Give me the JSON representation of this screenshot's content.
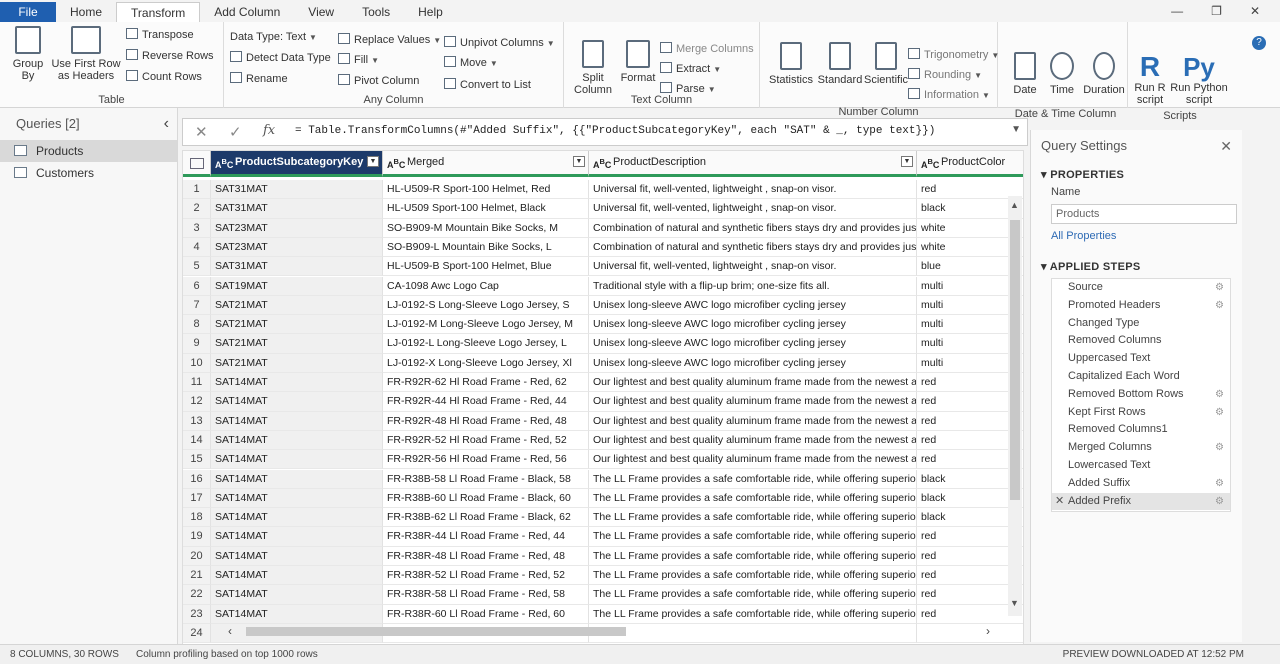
{
  "menu": {
    "tabs": [
      "File",
      "Home",
      "Transform",
      "Add Column",
      "View",
      "Tools",
      "Help"
    ],
    "active": "Transform"
  },
  "ribbon": {
    "table": {
      "label": "Table",
      "group_by": "Group\nBy",
      "use_first_row": "Use First Row\nas Headers",
      "transpose": "Transpose",
      "reverse_rows": "Reverse Rows",
      "count_rows": "Count Rows"
    },
    "any_column": {
      "label": "Any Column",
      "data_type": "Data Type: Text",
      "detect_data_type": "Detect Data Type",
      "rename": "Rename",
      "replace_values": "Replace Values",
      "fill": "Fill",
      "pivot_column": "Pivot Column",
      "unpivot_columns": "Unpivot Columns",
      "move": "Move",
      "convert_to_list": "Convert to List"
    },
    "text_column": {
      "label": "Text Column",
      "split_column": "Split\nColumn",
      "format": "Format",
      "merge_columns": "Merge Columns",
      "extract": "Extract",
      "parse": "Parse"
    },
    "number_column": {
      "label": "Number Column",
      "statistics": "Statistics",
      "standard": "Standard",
      "scientific": "Scientific",
      "trigonometry": "Trigonometry",
      "rounding": "Rounding",
      "information": "Information"
    },
    "datetime_column": {
      "label": "Date & Time Column",
      "date": "Date",
      "time": "Time",
      "duration": "Duration"
    },
    "scripts": {
      "label": "Scripts",
      "run_r": "Run R\nscript",
      "run_python": "Run Python\nscript"
    }
  },
  "queries": {
    "title": "Queries [2]",
    "items": [
      "Products",
      "Customers"
    ]
  },
  "formula": {
    "text": "= Table.TransformColumns(#\"Added Suffix\", {{\"ProductSubcategoryKey\", each \"SAT\" & _, type text}})"
  },
  "grid": {
    "columns": [
      "ProductSubcategoryKey",
      "Merged",
      "ProductDescription",
      "ProductColor"
    ],
    "rows": [
      [
        "1",
        "SAT31MAT",
        "HL-U509-R Sport-100 Helmet, Red",
        "Universal fit, well-vented, lightweight , snap-on visor.",
        "red"
      ],
      [
        "2",
        "SAT31MAT",
        "HL-U509 Sport-100 Helmet, Black",
        "Universal fit, well-vented, lightweight , snap-on visor.",
        "black"
      ],
      [
        "3",
        "SAT23MAT",
        "SO-B909-M Mountain Bike Socks, M",
        "Combination of natural and synthetic fibers stays dry and provides just...",
        "white"
      ],
      [
        "4",
        "SAT23MAT",
        "SO-B909-L Mountain Bike Socks, L",
        "Combination of natural and synthetic fibers stays dry and provides just...",
        "white"
      ],
      [
        "5",
        "SAT31MAT",
        "HL-U509-B Sport-100 Helmet, Blue",
        "Universal fit, well-vented, lightweight , snap-on visor.",
        "blue"
      ],
      [
        "6",
        "SAT19MAT",
        "CA-1098 Awc Logo Cap",
        "Traditional style with a flip-up brim; one-size fits all.",
        "multi"
      ],
      [
        "7",
        "SAT21MAT",
        "LJ-0192-S Long-Sleeve Logo Jersey, S",
        "Unisex long-sleeve AWC logo microfiber cycling jersey",
        "multi"
      ],
      [
        "8",
        "SAT21MAT",
        "LJ-0192-M Long-Sleeve Logo Jersey, M",
        "Unisex long-sleeve AWC logo microfiber cycling jersey",
        "multi"
      ],
      [
        "9",
        "SAT21MAT",
        "LJ-0192-L Long-Sleeve Logo Jersey, L",
        "Unisex long-sleeve AWC logo microfiber cycling jersey",
        "multi"
      ],
      [
        "10",
        "SAT21MAT",
        "LJ-0192-X Long-Sleeve Logo Jersey, Xl",
        "Unisex long-sleeve AWC logo microfiber cycling jersey",
        "multi"
      ],
      [
        "11",
        "SAT14MAT",
        "FR-R92R-62 Hl Road Frame - Red, 62",
        "Our lightest and best quality aluminum frame made from the newest a...",
        "red"
      ],
      [
        "12",
        "SAT14MAT",
        "FR-R92R-44 Hl Road Frame - Red, 44",
        "Our lightest and best quality aluminum frame made from the newest a...",
        "red"
      ],
      [
        "13",
        "SAT14MAT",
        "FR-R92R-48 Hl Road Frame - Red, 48",
        "Our lightest and best quality aluminum frame made from the newest a...",
        "red"
      ],
      [
        "14",
        "SAT14MAT",
        "FR-R92R-52 Hl Road Frame - Red, 52",
        "Our lightest and best quality aluminum frame made from the newest a...",
        "red"
      ],
      [
        "15",
        "SAT14MAT",
        "FR-R92R-56 Hl Road Frame - Red, 56",
        "Our lightest and best quality aluminum frame made from the newest a...",
        "red"
      ],
      [
        "16",
        "SAT14MAT",
        "FR-R38B-58 Ll Road Frame - Black, 58",
        "The LL Frame provides a safe comfortable ride, while offering superior ...",
        "black"
      ],
      [
        "17",
        "SAT14MAT",
        "FR-R38B-60 Ll Road Frame - Black, 60",
        "The LL Frame provides a safe comfortable ride, while offering superior ...",
        "black"
      ],
      [
        "18",
        "SAT14MAT",
        "FR-R38B-62 Ll Road Frame - Black, 62",
        "The LL Frame provides a safe comfortable ride, while offering superior ...",
        "black"
      ],
      [
        "19",
        "SAT14MAT",
        "FR-R38R-44 Ll Road Frame - Red, 44",
        "The LL Frame provides a safe comfortable ride, while offering superior ...",
        "red"
      ],
      [
        "20",
        "SAT14MAT",
        "FR-R38R-48 Ll Road Frame - Red, 48",
        "The LL Frame provides a safe comfortable ride, while offering superior ...",
        "red"
      ],
      [
        "21",
        "SAT14MAT",
        "FR-R38R-52 Ll Road Frame - Red, 52",
        "The LL Frame provides a safe comfortable ride, while offering superior ...",
        "red"
      ],
      [
        "22",
        "SAT14MAT",
        "FR-R38R-58 Ll Road Frame - Red, 58",
        "The LL Frame provides a safe comfortable ride, while offering superior ...",
        "red"
      ],
      [
        "23",
        "SAT14MAT",
        "FR-R38R-60 Ll Road Frame - Red, 60",
        "The LL Frame provides a safe comfortable ride, while offering superior ...",
        "red"
      ],
      [
        "24",
        "",
        "",
        "",
        ""
      ]
    ]
  },
  "settings": {
    "title": "Query Settings",
    "properties_label": "PROPERTIES",
    "name_label": "Name",
    "name_value": "Products",
    "all_properties": "All Properties",
    "applied_steps_label": "APPLIED STEPS",
    "steps": [
      {
        "name": "Source",
        "gear": true
      },
      {
        "name": "Promoted Headers",
        "gear": true
      },
      {
        "name": "Changed Type",
        "gear": false
      },
      {
        "name": "Removed Columns",
        "gear": false
      },
      {
        "name": "Uppercased Text",
        "gear": false
      },
      {
        "name": "Capitalized Each Word",
        "gear": false
      },
      {
        "name": "Removed Bottom Rows",
        "gear": true
      },
      {
        "name": "Kept First Rows",
        "gear": true
      },
      {
        "name": "Removed Columns1",
        "gear": false
      },
      {
        "name": "Merged Columns",
        "gear": true
      },
      {
        "name": "Lowercased Text",
        "gear": false
      },
      {
        "name": "Added Suffix",
        "gear": true
      },
      {
        "name": "Added Prefix",
        "gear": true
      }
    ],
    "active_step": "Added Prefix"
  },
  "status": {
    "columns_rows": "8 COLUMNS, 30 ROWS",
    "profiling": "Column profiling based on top 1000 rows",
    "preview": "PREVIEW DOWNLOADED AT 12:52 PM"
  }
}
